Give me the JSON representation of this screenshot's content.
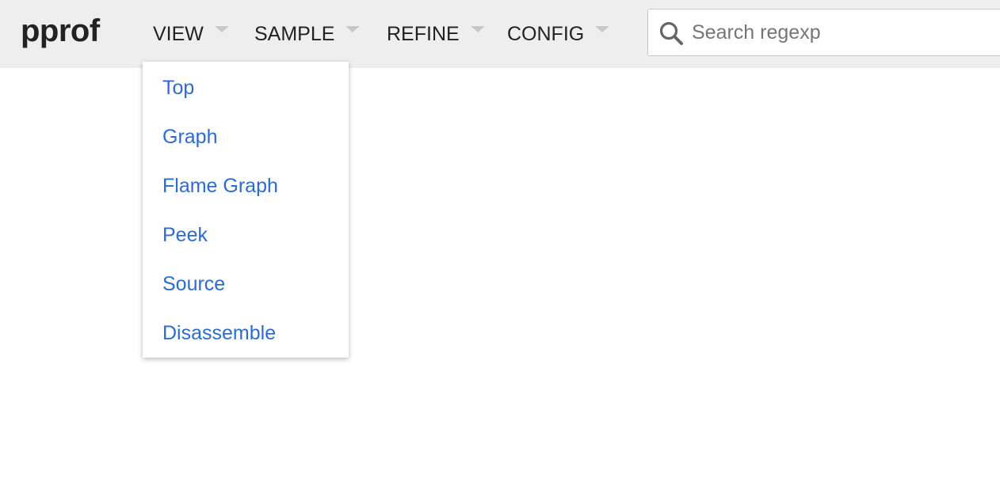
{
  "app": {
    "logo": "pprof"
  },
  "menubar": {
    "items": [
      {
        "label": "VIEW"
      },
      {
        "label": "SAMPLE"
      },
      {
        "label": "REFINE"
      },
      {
        "label": "CONFIG"
      }
    ]
  },
  "search": {
    "placeholder": "Search regexp",
    "value": ""
  },
  "view_dropdown": {
    "open": true,
    "items": [
      {
        "label": "Top"
      },
      {
        "label": "Graph"
      },
      {
        "label": "Flame Graph"
      },
      {
        "label": "Peek"
      },
      {
        "label": "Source"
      },
      {
        "label": "Disassemble"
      }
    ]
  },
  "colors": {
    "header_bg": "#eeeeee",
    "link": "#2a6bd6",
    "text": "#222222",
    "caret": "#c7c7c7"
  },
  "icons": {
    "search": "search-icon",
    "caret": "chevron-down-icon"
  }
}
